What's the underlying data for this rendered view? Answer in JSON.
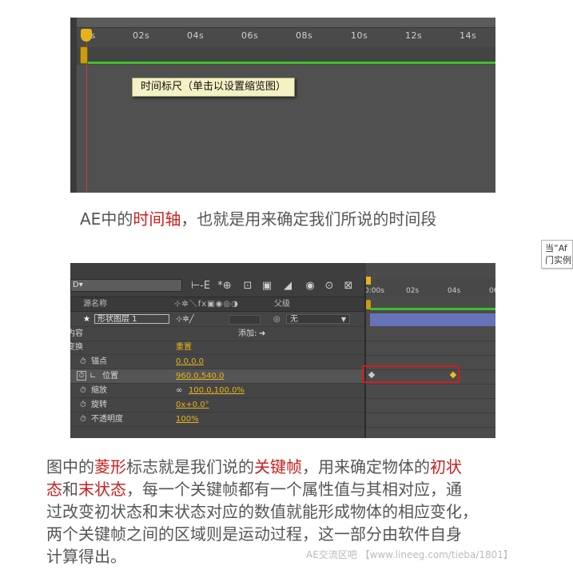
{
  "panel1": {
    "ticks": [
      "0s",
      "02s",
      "04s",
      "06s",
      "08s",
      "10s",
      "12s",
      "14s"
    ],
    "tooltip": "时间标尺（单击以设置缩览图）"
  },
  "caption1": {
    "pre": "AE中的",
    "highlight": "时间轴",
    "post": "，也就是用来确定我们所说的时间段"
  },
  "side_tooltip": {
    "line1": "当“Af",
    "line2": "门实例"
  },
  "panel2": {
    "search_value": "D▾",
    "toolbar_icons": [
      "⊢-E",
      "*⊕",
      "⊡",
      "▣",
      "◢",
      "◉",
      "⊙",
      "⊠"
    ],
    "header": {
      "source_name": "源名称",
      "switches": "⊹✲＼fx▣◉◎◑",
      "parent": "父级"
    },
    "layer": {
      "name": "形状图层 1",
      "switches": "⊹✲╱",
      "parent_value": "无"
    },
    "contents": {
      "label": "内容",
      "add": "添加:"
    },
    "transform": {
      "label": "变换",
      "reset": "重置"
    },
    "properties": [
      {
        "label": "锚点",
        "value": "0.0,0.0"
      },
      {
        "label": "位置",
        "value": "960.0,540.0"
      },
      {
        "label": "缩放",
        "value": "100.0,100.0%"
      },
      {
        "label": "旋转",
        "value": "0x+0.0°"
      },
      {
        "label": "不透明度",
        "value": "100%"
      }
    ],
    "timeline_ticks": [
      "0:00s",
      "02s",
      "04s",
      "06"
    ]
  },
  "paragraph": {
    "l1_pre": "图中的",
    "l1_hl1": "菱形",
    "l1_mid": "标志就是我们说的",
    "l1_hl2": "关键帧",
    "l1_post": "，用来确定物体的",
    "l1_hl3": "初状",
    "l2_hl1": "态",
    "l2_and": "和",
    "l2_hl2": "末状态",
    "l2_post": "，每一个关键帧都有一个属性值与其相对应，通",
    "l3": "过改变初状态和末状态对应的数值就能形成物体的相应变化，",
    "l4": "两个关键帧之间的区域则是运动过程，这一部分由软件自身",
    "l5": "计算得出。"
  },
  "watermark": "AE交流区吧 【www.lineeg.com/tieba/1801】",
  "colors": {
    "highlight": "#c8201e",
    "green_line": "#3fbf2c",
    "cti": "#e6b31a",
    "keyframe_box": "#d21e1e",
    "layer_bar": "#6673b8"
  }
}
